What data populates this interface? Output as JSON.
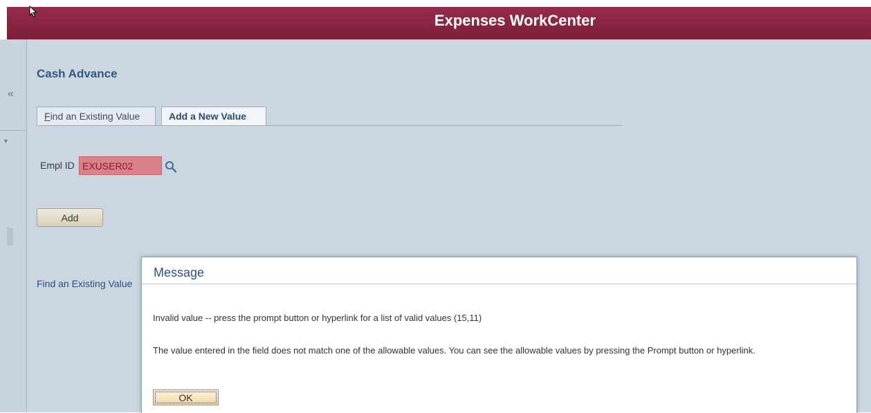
{
  "header": {
    "title": "Expenses WorkCenter"
  },
  "sidebar": {
    "collapse_glyph": "«",
    "dropdown_glyph": "▼"
  },
  "page": {
    "title": "Cash Advance"
  },
  "tabs": [
    {
      "label": "Find an Existing Value",
      "hotkey": "F",
      "rest": "ind an Existing Value"
    },
    {
      "label": "Add a New Value",
      "selected": true
    }
  ],
  "form": {
    "empl_id_label": "Empl ID",
    "empl_id_value": "EXUSER02",
    "add_button": "Add"
  },
  "links": {
    "find_existing": "Find an Existing Value"
  },
  "dialog": {
    "title": "Message",
    "line1": "Invalid value -- press the prompt button or hyperlink for a list of valid values (15,11)",
    "line2": "The value entered in the field does not match one of the allowable values.  You can see the allowable values by pressing the Prompt button or hyperlink.",
    "ok_button": "OK"
  },
  "colors": {
    "header_bg": "#8a2442",
    "page_bg": "#cbd6e0",
    "error_field_bg": "#d9808a",
    "link": "#2a4f7c"
  },
  "icons": [
    "cursor-icon",
    "collapse-icon",
    "dropdown-icon",
    "search-icon"
  ]
}
